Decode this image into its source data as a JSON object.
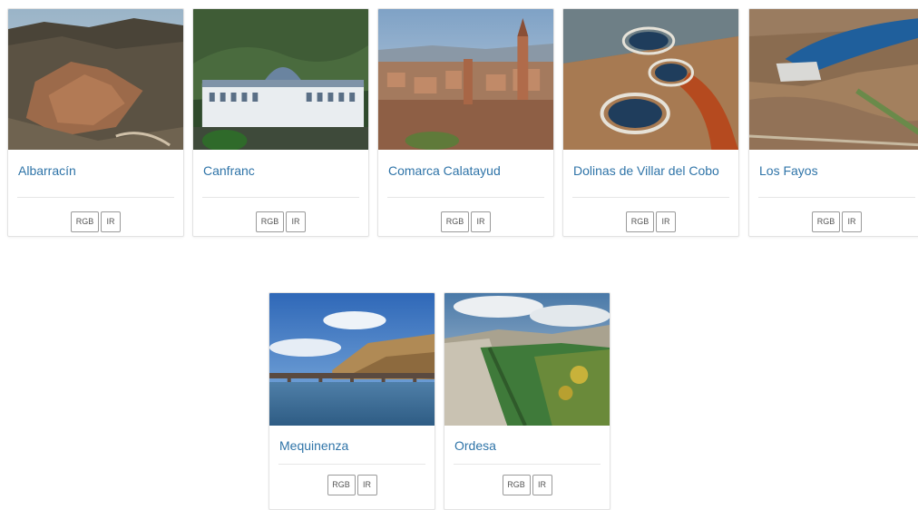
{
  "cards": [
    {
      "title": "Albarracín",
      "rgb": "RGB",
      "ir": "IR"
    },
    {
      "title": "Canfranc",
      "rgb": "RGB",
      "ir": "IR"
    },
    {
      "title": "Comarca Calatayud",
      "rgb": "RGB",
      "ir": "IR"
    },
    {
      "title": "Dolinas de Villar del Cobo",
      "rgb": "RGB",
      "ir": "IR"
    },
    {
      "title": "Los Fayos",
      "rgb": "RGB",
      "ir": "IR"
    },
    {
      "title": "Mequinenza",
      "rgb": "RGB",
      "ir": "IR"
    },
    {
      "title": "Ordesa",
      "rgb": "RGB",
      "ir": "IR"
    }
  ],
  "colors": {
    "title_link": "#2f74a8",
    "card_border": "#e3e3e3",
    "button_border": "#9a9a9a"
  }
}
